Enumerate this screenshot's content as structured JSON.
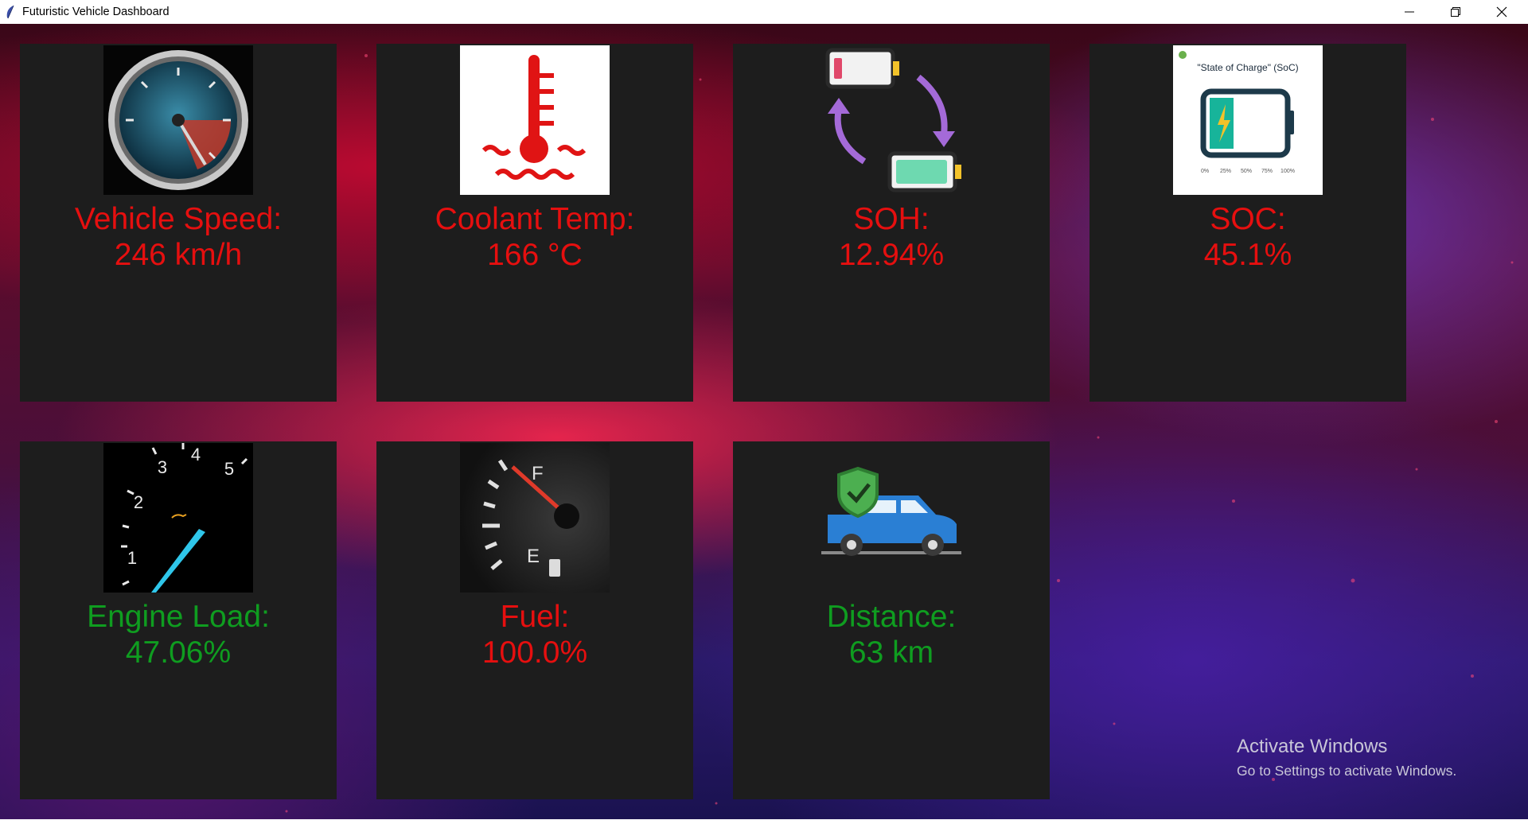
{
  "window": {
    "title": "Futuristic Vehicle Dashboard"
  },
  "colors": {
    "alert": "#e60f0f",
    "ok": "#0f9d20",
    "card": "#1d1d1d"
  },
  "cards": [
    {
      "label": "Vehicle Speed:",
      "value": "246 km/h",
      "status": "red",
      "icon": "speedometer-icon"
    },
    {
      "label": "Coolant Temp:",
      "value": "166 °C",
      "status": "red",
      "icon": "coolant-thermometer-icon"
    },
    {
      "label": "SOH:",
      "value": "12.94%",
      "status": "red",
      "icon": "battery-cycle-icon"
    },
    {
      "label": "SOC:",
      "value": "45.1%",
      "status": "red",
      "icon": "state-of-charge-icon",
      "image_text": {
        "title": "\"State of Charge\" (SoC)",
        "ticks": [
          "0%",
          "25%",
          "50%",
          "75%",
          "100%"
        ]
      }
    },
    {
      "label": "Engine Load:",
      "value": "47.06%",
      "status": "green",
      "icon": "tachometer-icon",
      "image_text": [
        "1",
        "2",
        "3",
        "4",
        "5"
      ]
    },
    {
      "label": "Fuel:",
      "value": "100.0%",
      "status": "red",
      "icon": "fuel-gauge-icon",
      "image_text": [
        "F",
        "E"
      ]
    },
    {
      "label": "Distance:",
      "value": "63 km",
      "status": "green",
      "icon": "car-shield-icon"
    }
  ],
  "watermark": {
    "line1": "Activate Windows",
    "line2": "Go to Settings to activate Windows."
  }
}
